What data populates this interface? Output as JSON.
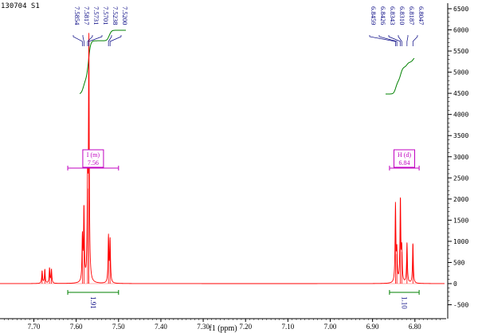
{
  "chart_data": {
    "type": "line",
    "title": "130704 S1",
    "xlabel": "f1 (ppm)",
    "ylabel": "",
    "xlim": [
      7.78,
      6.73
    ],
    "ylim": [
      -600,
      6600
    ],
    "x_ticks": [
      "7.70",
      "7.60",
      "7.50",
      "7.40",
      "7.30",
      "7.20",
      "7.10",
      "7.00",
      "6.90",
      "6.80"
    ],
    "y_ticks": [
      "-500",
      "0",
      "500",
      "1000",
      "1500",
      "2000",
      "2500",
      "3000",
      "3500",
      "4000",
      "4500",
      "5000",
      "5500",
      "6000",
      "6500"
    ],
    "peaks": [
      {
        "ppm": 7.6805,
        "height": 300
      },
      {
        "ppm": 7.6741,
        "height": 330
      },
      {
        "ppm": 7.663,
        "height": 360
      },
      {
        "ppm": 7.6585,
        "height": 330
      },
      {
        "ppm": 7.5854,
        "height": 1050
      },
      {
        "ppm": 7.5817,
        "height": 1750
      },
      {
        "ppm": 7.5731,
        "height": 2250
      },
      {
        "ppm": 7.5701,
        "height": 5700
      },
      {
        "ppm": 7.5238,
        "height": 1100
      },
      {
        "ppm": 7.52,
        "height": 1020
      },
      {
        "ppm": 6.8459,
        "height": 1850
      },
      {
        "ppm": 6.8426,
        "height": 700
      },
      {
        "ppm": 6.8343,
        "height": 2000
      },
      {
        "ppm": 6.831,
        "height": 750
      },
      {
        "ppm": 6.8187,
        "height": 950
      },
      {
        "ppm": 6.8047,
        "height": 950
      }
    ],
    "peak_labels": [
      {
        "group": "left",
        "values": [
          "7.5854",
          "7.5817",
          "7.5731",
          "7.5701",
          "7.5238",
          "7.5200"
        ]
      },
      {
        "group": "right",
        "values": [
          "6.8459",
          "6.8426",
          "6.8343",
          "6.8310",
          "6.8187",
          "6.8047"
        ]
      }
    ],
    "multiplets": [
      {
        "label": "I (m)",
        "shift": "7.56",
        "range": [
          7.62,
          7.5
        ]
      },
      {
        "label": "H (d)",
        "shift": "6.84",
        "range": [
          6.86,
          6.79
        ]
      }
    ],
    "integrals": [
      {
        "value": "1.91",
        "range": [
          7.62,
          7.5
        ]
      },
      {
        "value": "1.10",
        "range": [
          6.86,
          6.79
        ]
      }
    ],
    "colors": {
      "spectrum": "#ff0000",
      "integral_curve": "#008000",
      "peak_label": "#000080",
      "multiplet": "#c000c0",
      "axis": "#000000"
    }
  }
}
